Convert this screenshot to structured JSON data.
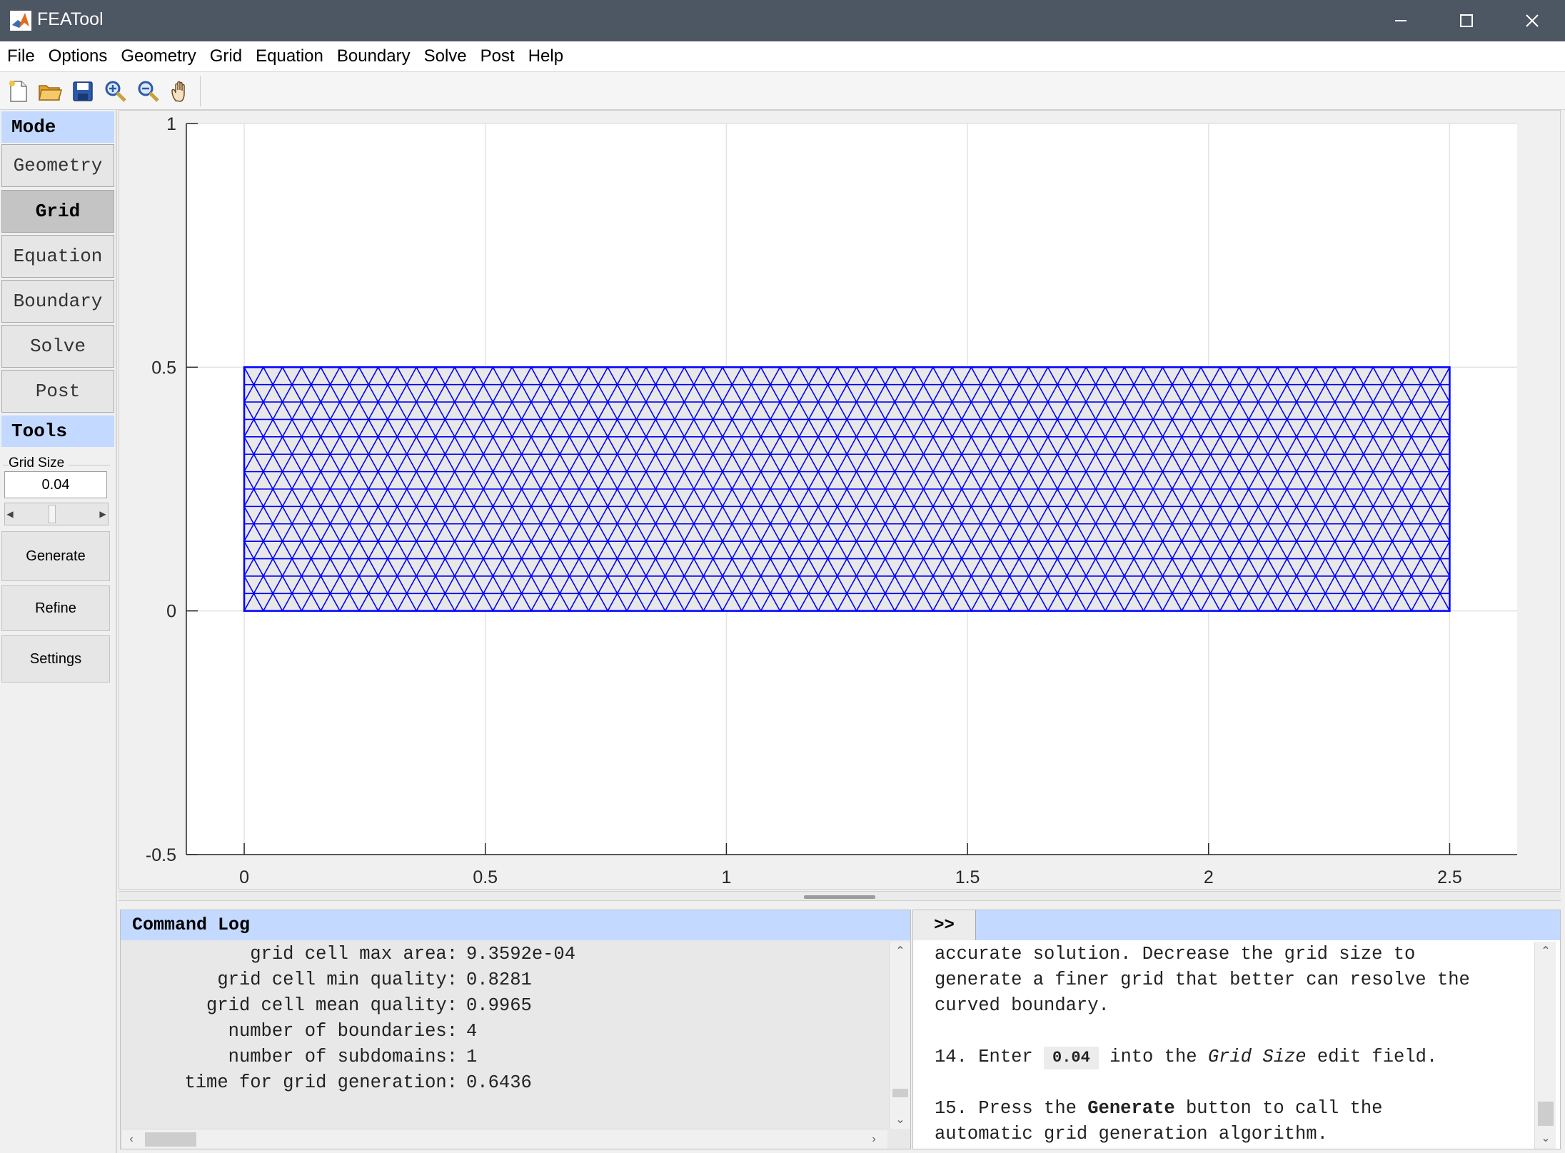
{
  "window": {
    "title": "FEATool",
    "controls": {
      "minimize": "minimize-icon",
      "maximize": "maximize-icon",
      "close": "close-icon"
    }
  },
  "menu": [
    "File",
    "Options",
    "Geometry",
    "Grid",
    "Equation",
    "Boundary",
    "Solve",
    "Post",
    "Help"
  ],
  "toolbar": {
    "buttons": [
      "new-file-icon",
      "open-folder-icon",
      "save-icon",
      "zoom-in-icon",
      "zoom-out-icon",
      "pan-hand-icon"
    ]
  },
  "mode_panel": {
    "header": "Mode",
    "buttons": [
      "Geometry",
      "Grid",
      "Equation",
      "Boundary",
      "Solve",
      "Post"
    ],
    "active": "Grid"
  },
  "tools_panel": {
    "header": "Tools",
    "grid_size_label": "Grid Size",
    "grid_size_value": "0.04",
    "slider_level": 0.5,
    "buttons": [
      "Generate",
      "Refine",
      "Settings"
    ]
  },
  "plot": {
    "x_ticks": [
      "0",
      "0.5",
      "1",
      "1.5",
      "2",
      "2.5"
    ],
    "y_ticks": [
      "1",
      "0.5",
      "0",
      "-0.5"
    ],
    "xlim": [
      -0.12,
      2.64
    ],
    "ylim": [
      -0.5,
      1.0
    ],
    "mesh": {
      "x_min": 0,
      "x_max": 2.5,
      "y_min": 0,
      "y_max": 0.5,
      "element_size": 0.04,
      "color": "#0000ff",
      "fill": "#e8e8e8"
    }
  },
  "command_log": {
    "header": "Command Log",
    "lines": [
      {
        "label": "grid cell max area:",
        "value": "9.3592e-04"
      },
      {
        "label": "grid cell min quality:",
        "value": "0.8281"
      },
      {
        "label": "grid cell mean quality:",
        "value": "0.9965"
      },
      {
        "label": "number of boundaries:",
        "value": "4"
      },
      {
        "label": "number of subdomains:",
        "value": "1"
      },
      {
        "label": "time for grid generation:",
        "value": "0.6436"
      }
    ]
  },
  "help": {
    "toggle": ">>",
    "line1": "accurate solution. Decrease the grid size to",
    "line2": "generate a finer grid that better can resolve the",
    "line3": "curved boundary.",
    "step14_prefix": "14. Enter ",
    "step14_code": "0.04",
    "step14_mid": " into the ",
    "step14_em": "Grid Size",
    "step14_suffix": " edit field.",
    "step15_prefix": "15. Press the ",
    "step15_bold": "Generate",
    "step15_suffix": " button to call the",
    "line_last": "automatic grid generation algorithm."
  },
  "colors": {
    "accent_header": "#c3d9ff",
    "titlebar": "#4d5663",
    "mesh_edge": "#0000ff"
  }
}
